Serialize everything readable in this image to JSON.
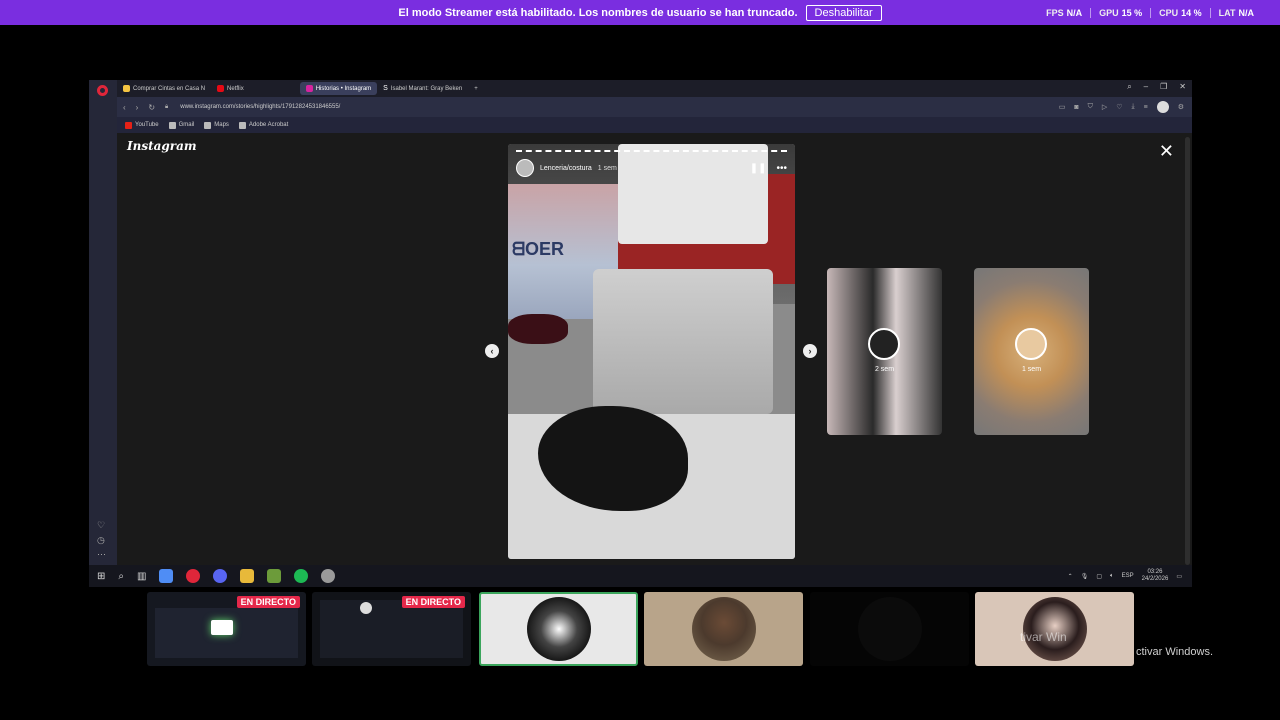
{
  "banner": {
    "message": "El modo Streamer está habilitado. Los nombres de usuario se han truncado.",
    "disable_label": "Deshabilitar",
    "stats": [
      {
        "label": "FPS",
        "value": "N/A"
      },
      {
        "label": "GPU",
        "value": "15 %"
      },
      {
        "label": "CPU",
        "value": "14 %"
      },
      {
        "label": "LAT",
        "value": "N/A"
      }
    ]
  },
  "browser": {
    "tabs": [
      {
        "label": "Comprar Cintas en Casa N",
        "color": "#f5c542",
        "active": false
      },
      {
        "label": "Netflix",
        "color": "#e50914",
        "active": false
      },
      {
        "label": "Historias • Instagram",
        "color": "#d6249f",
        "active": true
      },
      {
        "label": "Isabel Marant: Gray Beken",
        "color": "#ffffff",
        "active": false
      }
    ],
    "url": "www.instagram.com/stories/highlights/17912824531846555/",
    "bookmarks": [
      "YouTube",
      "Gmail",
      "Maps",
      "Adobe Acrobat"
    ]
  },
  "instagram": {
    "logo": "Instagram",
    "story": {
      "user": "Lenceria/costura",
      "time": "1 sem",
      "shirt_text": "ᗺOER"
    },
    "thumbs": [
      {
        "time": "2 sem"
      },
      {
        "time": "1 sem"
      }
    ]
  },
  "taskbar": {
    "lang": "ESP",
    "time": "03:26",
    "date": "24/2/2026"
  },
  "tiles": [
    {
      "live": "EN DIRECTO"
    },
    {
      "live": "EN DIRECTO"
    }
  ],
  "watermark": {
    "ghost": "tivar Win",
    "text": "ctivar Windows."
  },
  "colors": {
    "banner": "#7a2ee0",
    "live_badge": "#e5284a",
    "speaking_border": "#3ba55c",
    "opera_red": "#e0263a"
  }
}
